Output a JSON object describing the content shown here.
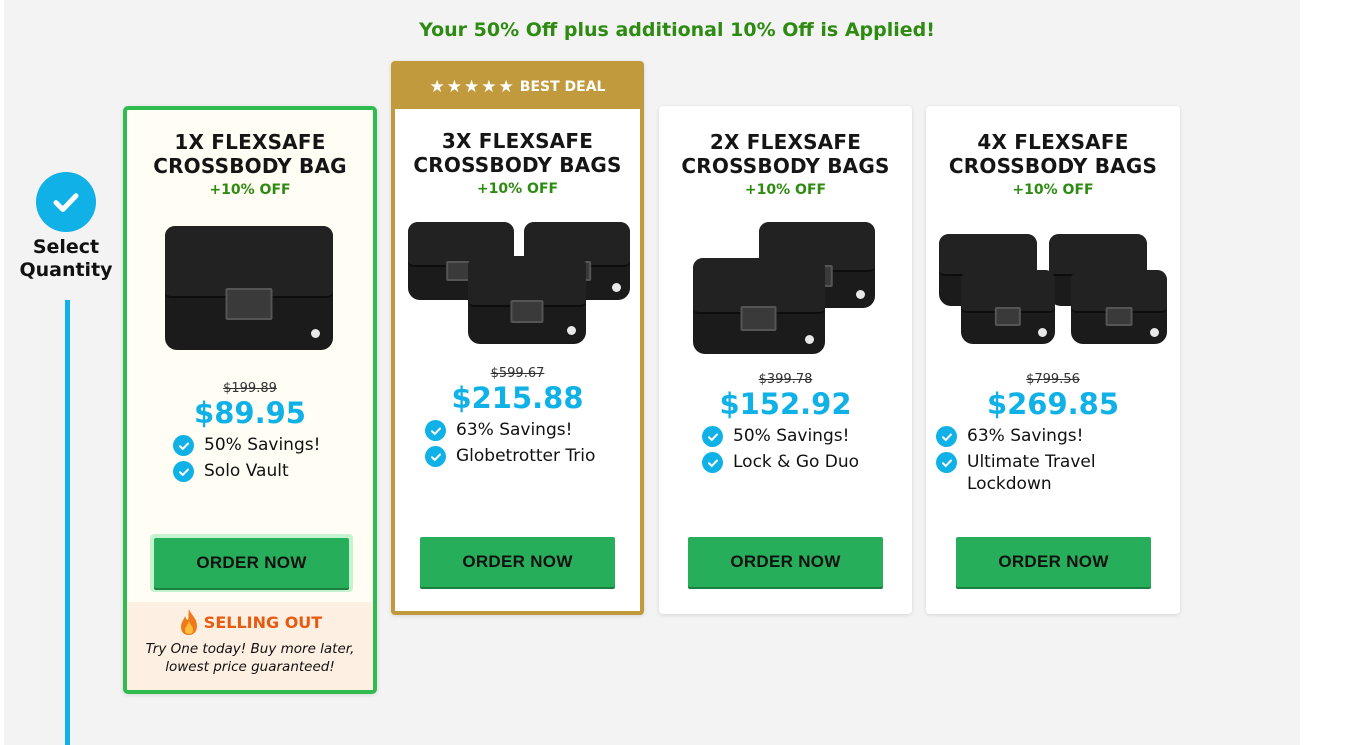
{
  "promo_text": "Your 50% Off plus additional 10% Off is Applied!",
  "step": {
    "label_line1": "Select",
    "label_line2": "Quantity"
  },
  "colors": {
    "accent": "#0fb1e6",
    "green": "#27ae5a",
    "gold": "#c29a3e",
    "promo_green": "#2e8b12",
    "selling_orange": "#e85a10"
  },
  "cards": [
    {
      "title_line1": "1X FLEXSAFE",
      "title_line2": "CROSSBODY BAG",
      "off": "+10% OFF",
      "old_price": "$199.89",
      "price": "$89.95",
      "features": [
        "50% Savings!",
        "Solo Vault"
      ],
      "button": "ORDER NOW",
      "selected": true,
      "selling_title": "SELLING OUT",
      "selling_text_line1": "Try One today! Buy more later,",
      "selling_text_line2": "lowest price guaranteed!"
    },
    {
      "badge": "BEST DEAL",
      "stars": 5,
      "title_line1": "3X FLEXSAFE",
      "title_line2": "CROSSBODY BAGS",
      "off": "+10% OFF",
      "old_price": "$599.67",
      "price": "$215.88",
      "features": [
        "63% Savings!",
        "Globetrotter Trio"
      ],
      "button": "ORDER NOW"
    },
    {
      "title_line1": "2X FLEXSAFE",
      "title_line2": "CROSSBODY BAGS",
      "off": "+10% OFF",
      "old_price": "$399.78",
      "price": "$152.92",
      "features": [
        "50% Savings!",
        "Lock & Go Duo"
      ],
      "button": "ORDER NOW"
    },
    {
      "title_line1": "4X FLEXSAFE",
      "title_line2": "CROSSBODY BAGS",
      "off": "+10% OFF",
      "old_price": "$799.56",
      "price": "$269.85",
      "features": [
        "63% Savings!",
        "Ultimate Travel Lockdown"
      ],
      "button": "ORDER NOW"
    }
  ]
}
